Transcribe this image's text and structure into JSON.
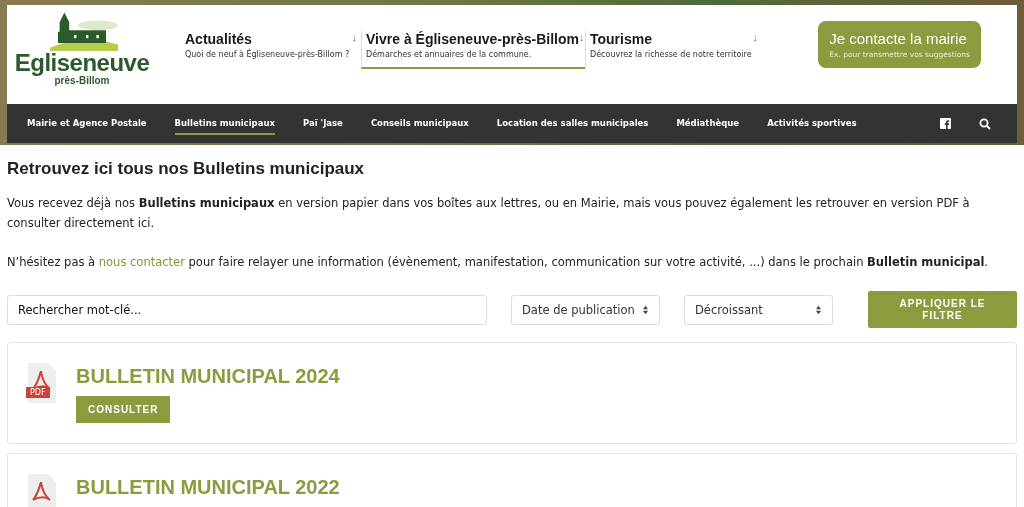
{
  "logo": {
    "name": "Egliseneuve",
    "sub": "près-Billom"
  },
  "main_menu": [
    {
      "title": "Actualités",
      "subtitle": "Quoi de neuf à Égliseneuve-près-Billom ?",
      "arrow": "↓",
      "selected": false
    },
    {
      "title": "Vivre à Égliseneuve-près-Billom",
      "subtitle": "Démarches et annuaires de la commune.",
      "arrow": "↓",
      "selected": true
    },
    {
      "title": "Tourisme",
      "subtitle": "Découvrez la richesse de notre territoire",
      "arrow": "↓",
      "selected": false
    }
  ],
  "contact_button": {
    "title": "Je contacte la mairie",
    "subtitle": "Ex. pour transmettre vos suggestions"
  },
  "nav": [
    {
      "label": "Mairie et Agence Postale",
      "selected": false
    },
    {
      "label": "Bulletins municipaux",
      "selected": true
    },
    {
      "label": "Paï 'Jase",
      "selected": false
    },
    {
      "label": "Conseils municipaux",
      "selected": false
    },
    {
      "label": "Location des salles municipales",
      "selected": false
    },
    {
      "label": "Médiathèque",
      "selected": false
    },
    {
      "label": "Activités sportives",
      "selected": false
    }
  ],
  "page_title": "Retrouvez ici tous nos Bulletins municipaux",
  "intro": "Vous recevez déjà nos **Bulletins municipaux** en version papier dans vos boîtes aux lettres, ou en Mairie, mais vous pouvez également les retrouver en version PDF à consulter directement ici.",
  "contact_paragraph": {
    "before": "N’hésitez pas à",
    "link": "nous contacter",
    "after": "pour faire relayer une information (évènement, manifestation, communication sur votre activité, ...) dans le prochain **Bulletin municipal**."
  },
  "filters": {
    "search": {
      "placeholder": "Rechercher mot-clé..."
    },
    "sort_by": "Date de publication",
    "order": "Décroissant",
    "apply_button": "APPLIQUER LE FILTRE"
  },
  "bulletins": [
    {
      "title": "BULLETIN MUNICIPAL 2024",
      "file_label": "PDF",
      "button": "CONSULTER"
    },
    {
      "title": "BULLETIN MUNICIPAL 2022"
    }
  ]
}
